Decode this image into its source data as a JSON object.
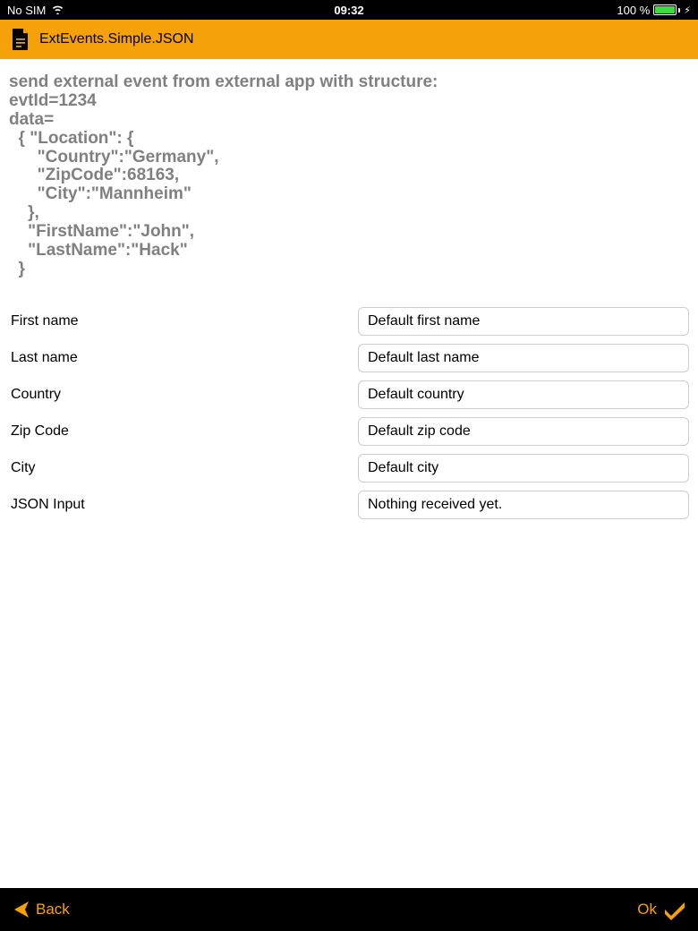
{
  "status_bar": {
    "carrier": "No SIM",
    "time": "09:32",
    "battery_pct": "100 %"
  },
  "header": {
    "title": "ExtEvents.Simple.JSON"
  },
  "instructions": {
    "line1": "send external event from external app with structure:",
    "line2": "evtId=1234",
    "line3": "data=",
    "line4": "  { \"Location\": {",
    "line5": "      \"Country\":\"Germany\",",
    "line6": "      \"ZipCode\":68163,",
    "line7": "      \"City\":\"Mannheim\"",
    "line8": "    },",
    "line9": "    \"FirstName\":\"John\",",
    "line10": "    \"LastName\":\"Hack\"",
    "line11": "  }"
  },
  "form": {
    "fields": [
      {
        "label": "First name",
        "value": "Default first name"
      },
      {
        "label": "Last name",
        "value": "Default last name"
      },
      {
        "label": "Country",
        "value": "Default country"
      },
      {
        "label": "Zip Code",
        "value": "Default zip code"
      },
      {
        "label": "City",
        "value": "Default city"
      },
      {
        "label": "JSON Input",
        "value": "Nothing received yet."
      }
    ]
  },
  "bottom": {
    "back_label": "Back",
    "ok_label": "Ok"
  }
}
